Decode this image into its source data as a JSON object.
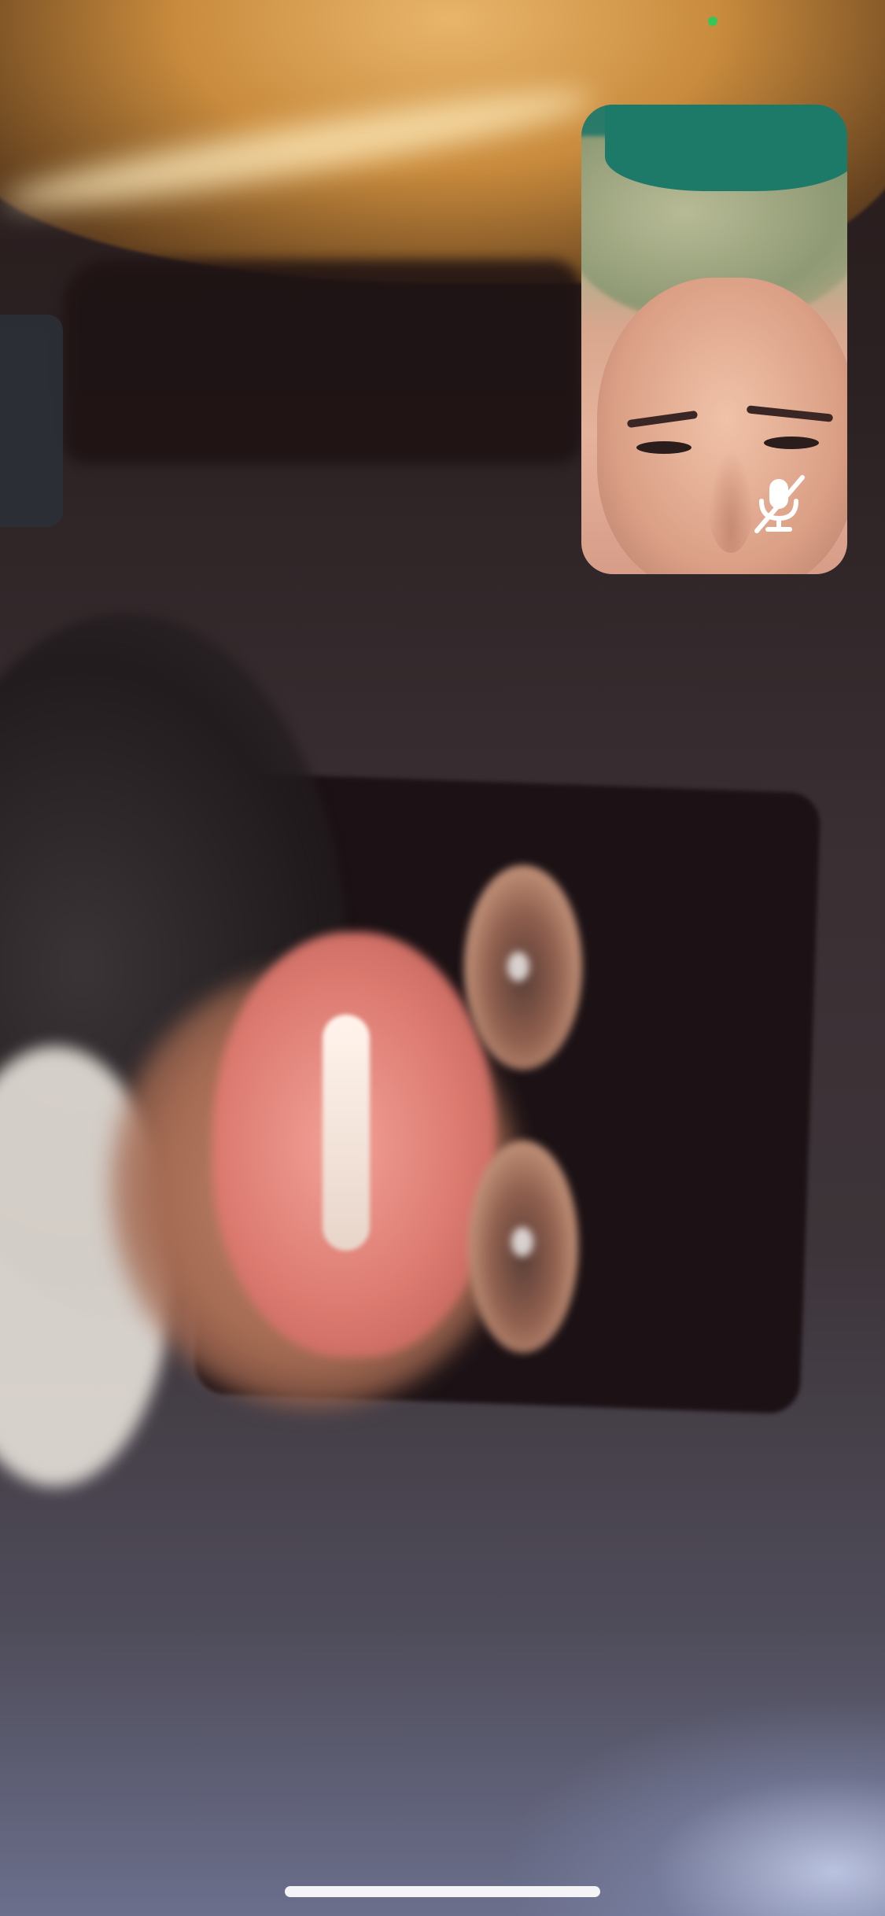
{
  "call": {
    "remote_video_label": "",
    "self_view": {
      "microphone_state": "muted",
      "icon": "microphone-slash-icon"
    },
    "status_indicator_color": "#33c759"
  },
  "colors": {
    "home_indicator": "#f4f4f6",
    "mute_icon": "#ffffff"
  }
}
